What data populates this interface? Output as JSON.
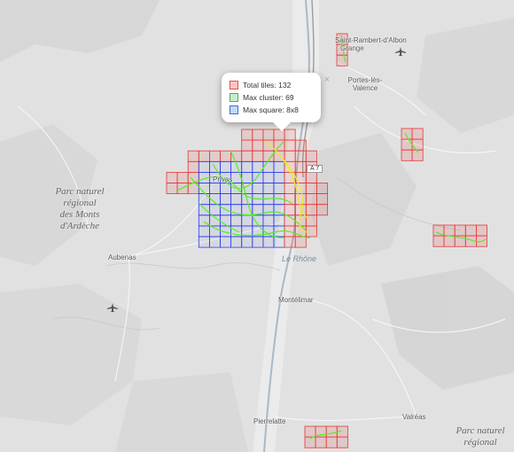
{
  "map": {
    "places": [
      {
        "name": "Saint-Rambert-d'Albon"
      },
      {
        "name": "Grange"
      },
      {
        "name": "Portes-lès-Valence"
      },
      {
        "name": "Privas"
      },
      {
        "name": "Aubenas"
      },
      {
        "name": "Montélimar"
      },
      {
        "name": "Pierrelatte"
      },
      {
        "name": "Valréas"
      }
    ],
    "park_west": [
      "Parc naturel",
      "régional",
      "des Monts",
      "d'Ardèche"
    ],
    "park_east": [
      "Parc naturel",
      "régional"
    ],
    "river": "Le Rhône",
    "road": "A 7",
    "icons": [
      "airport-icon",
      "airport-icon"
    ]
  },
  "popup": {
    "close": "×",
    "legend": [
      {
        "label": "Total tiles: 132",
        "fill": "#f5c6c6",
        "stroke": "#e05050"
      },
      {
        "label": "Max cluster: 69",
        "fill": "#c9ead0",
        "stroke": "#4caf62"
      },
      {
        "label": "Max square: 8x8",
        "fill": "#c7d8f5",
        "stroke": "#3c6fd8"
      }
    ]
  },
  "colors": {
    "tile_red": "#e53935",
    "tile_blue": "#2a3ee8",
    "track_green": "#55ee22",
    "track_yellow": "#e8ee22"
  }
}
